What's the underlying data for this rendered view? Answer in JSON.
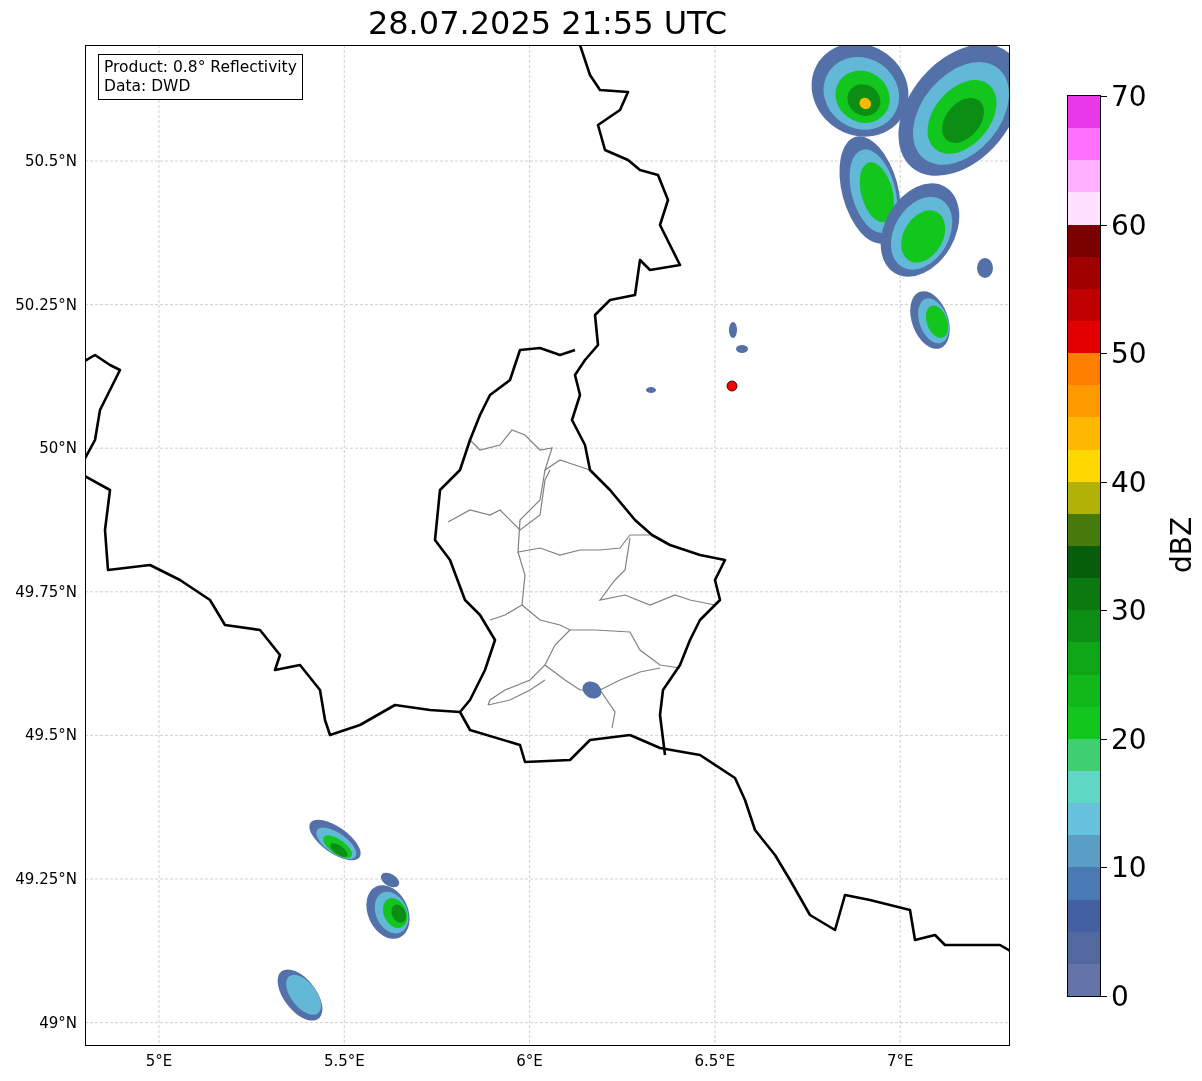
{
  "title": "28.07.2025 21:55 UTC",
  "info_box": [
    "Product: 0.8° Reflectivity",
    "Data: DWD"
  ],
  "y_ticks": [
    {
      "label": "50.5°N"
    },
    {
      "label": "50.25°N"
    },
    {
      "label": "50°N"
    },
    {
      "label": "49.75°N"
    },
    {
      "label": "49.5°N"
    },
    {
      "label": "49.25°N"
    },
    {
      "label": "49°N"
    }
  ],
  "x_ticks": [
    {
      "label": "5°E"
    },
    {
      "label": "5.5°E"
    },
    {
      "label": "6°E"
    },
    {
      "label": "6.5°E"
    },
    {
      "label": "7°E"
    }
  ],
  "colorbar": {
    "label": "dBZ",
    "ticks": [
      "70",
      "60",
      "50",
      "40",
      "30",
      "20",
      "10",
      "0"
    ],
    "bands": [
      {
        "color": "#e838e8"
      },
      {
        "color": "#ff70ff"
      },
      {
        "color": "#ffb0ff"
      },
      {
        "color": "#ffe0ff"
      },
      {
        "color": "#7a0000"
      },
      {
        "color": "#a00000"
      },
      {
        "color": "#c00000"
      },
      {
        "color": "#e40000"
      },
      {
        "color": "#fe7e00"
      },
      {
        "color": "#fe9a00"
      },
      {
        "color": "#feb800"
      },
      {
        "color": "#fed800"
      },
      {
        "color": "#b0b208"
      },
      {
        "color": "#467a0a"
      },
      {
        "color": "#065e0a"
      },
      {
        "color": "#0a7a10"
      },
      {
        "color": "#0c8e14"
      },
      {
        "color": "#0ea616"
      },
      {
        "color": "#10b81a"
      },
      {
        "color": "#12c61e"
      },
      {
        "color": "#3ed070"
      },
      {
        "color": "#60d6c4"
      },
      {
        "color": "#66c2da"
      },
      {
        "color": "#5a9ec6"
      },
      {
        "color": "#4a7ab4"
      },
      {
        "color": "#4560a0"
      },
      {
        "color": "#5468a0"
      },
      {
        "color": "#6474a8"
      }
    ]
  }
}
